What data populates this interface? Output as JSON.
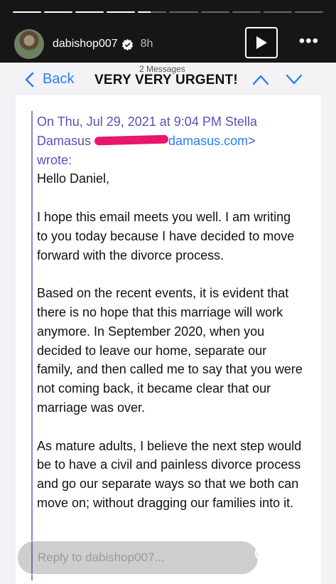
{
  "story": {
    "username": "dabishop007",
    "time_ago": "8h",
    "more_label": "•••"
  },
  "mail": {
    "back_label": "Back",
    "messages_count": "2 Messages",
    "subject": "VERY VERY URGENT!",
    "quote_header_line1": "On Thu, Jul 29, 2021 at 9:04 PM Stella",
    "quote_header_name": "Damasus",
    "quote_header_email_visible": "damasus.com",
    "quote_header_close": ">",
    "quote_header_wrote": "wrote:",
    "greeting": "Hello Daniel,",
    "paragraphs": [
      "I hope this email meets you well. I am writing to you today because I have decided to move forward with the divorce process.",
      "Based on the recent events, it is evident that there is no hope that this marriage will work anymore. In September 2020, when you decided to leave our home, separate our family, and then called me to say that you were not coming back, it became clear that our marriage was over.",
      "As mature adults, I believe the next step would be to have a civil and painless divorce process and go our separate ways so that we both can move on; without dragging our families into it."
    ]
  },
  "reply": {
    "placeholder": "Reply to dabishop007..."
  },
  "colors": {
    "link_blue": "#2b7df6",
    "quote_purple": "#5e4fb7",
    "redaction_pink": "#e8166d"
  }
}
